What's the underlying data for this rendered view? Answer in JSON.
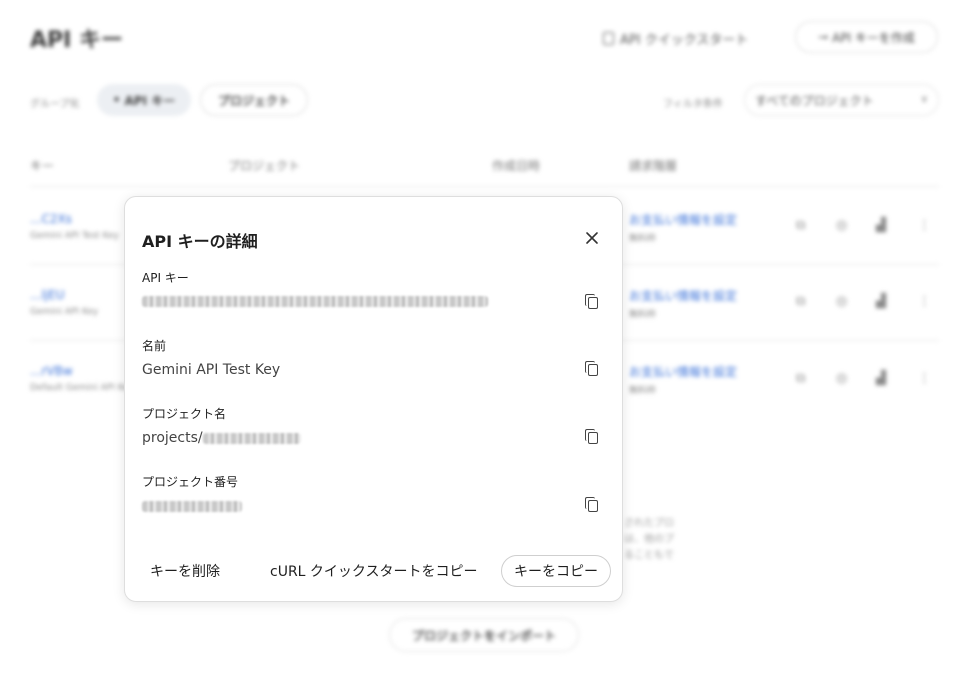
{
  "page": {
    "title": "API キー",
    "quickstart_link": "API クイックスタート",
    "create_key_button": "API キーを作成",
    "group_label": "グループ化",
    "group_chip_active": "API キー",
    "group_chip_project": "プロジェクト",
    "filter_label": "フィルタ条件",
    "filter_value": "すべてのプロジェクト",
    "columns": [
      "キー",
      "プロジェクト",
      "作成日時",
      "請求階層"
    ],
    "rows": [
      {
        "key": "...C2Xs",
        "name": "Gemini API Test Key",
        "billing": "お支払い情報を設定",
        "tier": "無料枠"
      },
      {
        "key": "...ljEU",
        "name": "Gemini API Key",
        "billing": "お支払い情報を設定",
        "tier": "無料枠"
      },
      {
        "key": "...rVBw",
        "name": "Default Gemini API Key",
        "billing": "お支払い情報を設定",
        "tier": "無料枠"
      }
    ],
    "note_lines": [
      "されたプロ",
      "は、他のプ",
      "ることもで"
    ],
    "import_button": "プロジェクトをインポート"
  },
  "dialog": {
    "title": "API キーの詳細",
    "fields": [
      {
        "label": "API キー",
        "value": ""
      },
      {
        "label": "名前",
        "value": "Gemini API Test Key"
      },
      {
        "label": "プロジェクト名",
        "value": "projects/"
      },
      {
        "label": "プロジェクト番号",
        "value": ""
      }
    ],
    "delete_button": "キーを削除",
    "curl_button": "cURL クイックスタートをコピー",
    "copy_button": "キーをコピー"
  },
  "colors": {
    "link": "#3b72d9",
    "text": "#1f1f1f"
  },
  "icons": [
    "close-icon",
    "copy-icon",
    "document-icon",
    "key-icon",
    "chevron-down-icon",
    "more-vert-icon"
  ]
}
